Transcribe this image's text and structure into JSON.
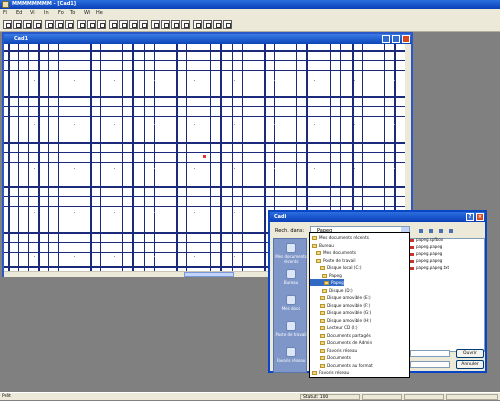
{
  "app": {
    "title": "MMMMMMMM - [Cad1]",
    "menu": [
      "Fi",
      "Ed",
      "Vi",
      "In",
      "Fo",
      "To",
      "Wi",
      "He"
    ]
  },
  "toolbar": {
    "buttons": [
      "new-icon",
      "open-icon",
      "save-icon",
      "print-icon",
      "cut-icon",
      "copy-icon",
      "paste-icon",
      "pointer-icon",
      "rotate-icon",
      "zoom-icon",
      "rect-icon",
      "line-icon",
      "text-icon",
      "grid-icon",
      "align-left-icon",
      "align-center-icon",
      "align-right-icon",
      "bold-icon"
    ]
  },
  "child_window": {
    "title": "Cad1"
  },
  "dialog": {
    "title": "Cadi",
    "lookin_label": "Rech. dans:",
    "lookin_value": "Papeg",
    "help_glyph": "?",
    "close_glyph": "×",
    "places": [
      {
        "label": "Mes documents récents",
        "icon": "recent-icon"
      },
      {
        "label": "Bureau",
        "icon": "desktop-icon"
      },
      {
        "label": "Mes docs",
        "icon": "documents-icon"
      },
      {
        "label": "Poste de travail",
        "icon": "computer-icon"
      },
      {
        "label": "Favoris réseau",
        "icon": "network-icon"
      }
    ],
    "dropdown": [
      "Mes documents récents",
      "Bureau",
      "Mes documents",
      "Poste de travail",
      "Disque local (C:)",
      "Papeg",
      "Papeg",
      "Disque (D:)",
      "Disque amovible (E:)",
      "Disque amovible (F:)",
      "Disque amovible (G:)",
      "Disque amovible (H:)",
      "Lecteur CD (I:)",
      "Documents partagés",
      "Documents de Admin",
      "Favoris réseau",
      "Documents",
      "Documents au format",
      "Favoris réseau"
    ],
    "files": [
      "papeg.spfbox",
      "papeg.papeg",
      "papeg.papeg",
      "papeg.papeg",
      "papeg.papeg.txt"
    ],
    "buttons": {
      "open": "Ouvrir",
      "cancel": "Annuler"
    }
  },
  "status": {
    "left": "Prêt",
    "panes": [
      "Statut: 100",
      "",
      "",
      ""
    ]
  }
}
